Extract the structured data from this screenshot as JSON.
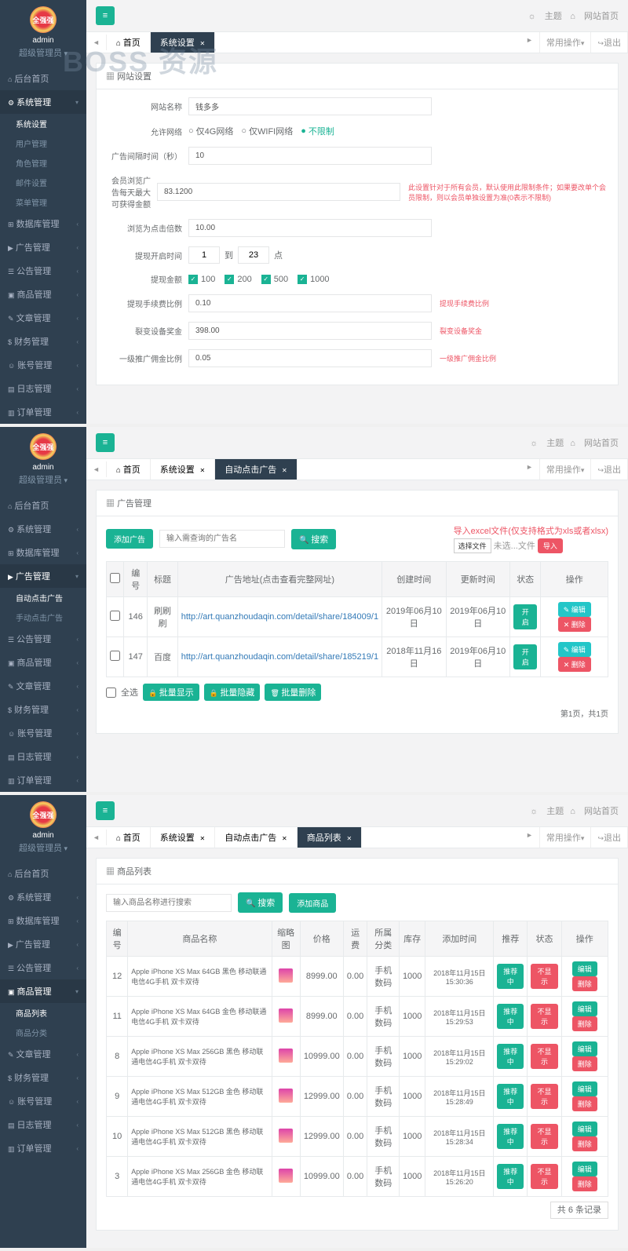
{
  "watermark": "BOSS 资源",
  "top": {
    "theme": "主题",
    "home": "网站首页",
    "common": "常用操作",
    "exit": "退出"
  },
  "tabs": {
    "home": "首页",
    "settings": "系统设置",
    "autoAd": "自动点击广告",
    "goods": "商品列表"
  },
  "sidebar": {
    "admin": "admin",
    "role": "超级管理员",
    "items": [
      "后台首页",
      "系统管理",
      "数据库管理",
      "广告管理",
      "公告管理",
      "商品管理",
      "文章管理",
      "财务管理",
      "账号管理",
      "日志管理",
      "订单管理"
    ],
    "sysSub": [
      "系统设置",
      "用户管理",
      "角色管理",
      "邮件设置",
      "菜单管理"
    ],
    "adSub": [
      "自动点击广告",
      "手动点击广告"
    ],
    "goodsSub": [
      "商品列表",
      "商品分类"
    ]
  },
  "p1": {
    "cardTitle": "网站设置",
    "labels": {
      "siteName": "网站名称",
      "network": "允许网络",
      "adInterval": "广告间隔时间（秒）",
      "dailyMax": "会员浏览广告每天最大可获得金额",
      "clickMulti": "浏览为点击倍数",
      "withdrawTime": "提现开启时间",
      "withdrawAmt": "提现金额",
      "feeRatio": "提现手续费比例",
      "deviceBonus": "裂变设备奖金",
      "l1Ratio": "一级推广佣金比例"
    },
    "values": {
      "siteName": "钱多多",
      "adInterval": "10",
      "dailyMax": "83.1200",
      "clickMulti": "10.00",
      "t1": "1",
      "t2": "23",
      "feeRatio": "0.10",
      "deviceBonus": "398.00",
      "l1Ratio": "0.05"
    },
    "radios": [
      "仅4G网络",
      "仅WIFI网络",
      "不限制"
    ],
    "timeTo": "到",
    "timePoint": "点",
    "amounts": [
      "100",
      "200",
      "500",
      "1000"
    ],
    "helps": {
      "dailyMax": "此设置针对于所有会员，默认使用此限制条件；如果要改单个会员限制，则以会员单独设置为准(0表示不限制)",
      "feeRatio": "提现手续费比例",
      "deviceBonus": "裂变设备奖金",
      "l1Ratio": "一级推广佣金比例"
    }
  },
  "p2": {
    "cardTitle": "广告管理",
    "addBtn": "添加广告",
    "searchPh": "输入需查询的广告名",
    "searchBtn": "搜索",
    "importTitle": "导入excel文件(仅支持格式为xls或者xlsx)",
    "chooseFile": "选择文件",
    "noFile": "未选...文件",
    "importBtn": "导入",
    "cols": [
      "编号",
      "标题",
      "广告地址(点击查看完整网址)",
      "创建时间",
      "更新时间",
      "状态",
      "操作"
    ],
    "rows": [
      {
        "id": "146",
        "title": "刷刷刷",
        "url": "http://art.quanzhoudaqin.com/detail/share/184009/1",
        "ct": "2019年06月10日",
        "ut": "2019年06月10日"
      },
      {
        "id": "147",
        "title": "百度",
        "url": "http://art.quanzhoudaqin.com/detail/share/185219/1",
        "ct": "2018年11月16日",
        "ut": "2019年06月10日"
      }
    ],
    "status": "开启",
    "edit": "编辑",
    "del": "删除",
    "selectAll": "全选",
    "batchShow": "批量显示",
    "batchHide": "批量隐藏",
    "batchDel": "批量删除",
    "pager": "第1页，共1页"
  },
  "p3": {
    "cardTitle": "商品列表",
    "searchPh": "输入商品名称进行搜索",
    "searchBtn": "搜索",
    "addBtn": "添加商品",
    "cols": [
      "编号",
      "商品名称",
      "缩略图",
      "价格",
      "运费",
      "所属分类",
      "库存",
      "添加时间",
      "推荐",
      "状态",
      "操作"
    ],
    "rows": [
      {
        "id": "12",
        "name": "Apple iPhone XS Max 64GB 黑色 移动联通电信4G手机 双卡双待",
        "price": "8999.00",
        "ship": "0.00",
        "cat": "手机数码",
        "stock": "1000",
        "time": "2018年11月15日 15:30:36",
        "rec": "推荐中",
        "status": "不显示"
      },
      {
        "id": "11",
        "name": "Apple iPhone XS Max 64GB 金色 移动联通电信4G手机 双卡双待",
        "price": "8999.00",
        "ship": "0.00",
        "cat": "手机数码",
        "stock": "1000",
        "time": "2018年11月15日 15:29:53",
        "rec": "推荐中",
        "status": "不显示"
      },
      {
        "id": "8",
        "name": "Apple iPhone XS Max 256GB 黑色 移动联通电信4G手机 双卡双待",
        "price": "10999.00",
        "ship": "0.00",
        "cat": "手机数码",
        "stock": "1000",
        "time": "2018年11月15日 15:29:02",
        "rec": "推荐中",
        "status": "不显示"
      },
      {
        "id": "9",
        "name": "Apple iPhone XS Max 512GB 金色 移动联通电信4G手机 双卡双待",
        "price": "12999.00",
        "ship": "0.00",
        "cat": "手机数码",
        "stock": "1000",
        "time": "2018年11月15日 15:28:49",
        "rec": "推荐中",
        "status": "不显示"
      },
      {
        "id": "10",
        "name": "Apple iPhone XS Max 512GB 黑色 移动联通电信4G手机 双卡双待",
        "price": "12999.00",
        "ship": "0.00",
        "cat": "手机数码",
        "stock": "1000",
        "time": "2018年11月15日 15:28:34",
        "rec": "推荐中",
        "status": "不显示"
      },
      {
        "id": "3",
        "name": "Apple iPhone XS Max 256GB 金色 移动联通电信4G手机 双卡双待",
        "price": "10999.00",
        "ship": "0.00",
        "cat": "手机数码",
        "stock": "1000",
        "time": "2018年11月15日 15:26:20",
        "rec": "推荐中",
        "status": "不显示"
      }
    ],
    "edit": "编辑",
    "del": "删除",
    "pager": "共 6 条记录"
  }
}
